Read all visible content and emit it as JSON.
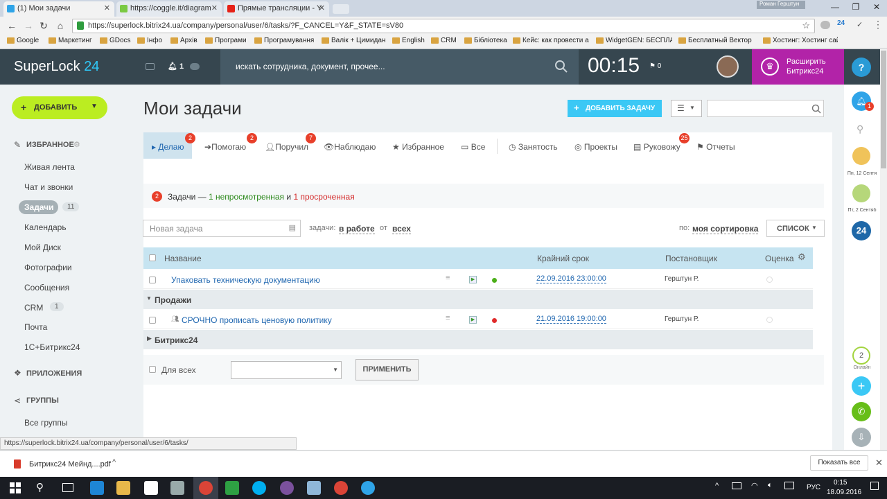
{
  "browser": {
    "tabs": [
      {
        "label": "(1) Мои задачи"
      },
      {
        "label": "https://coggle.it/diagram"
      },
      {
        "label": "Прямые трансляции - Y"
      }
    ],
    "profile_name": "Роман Герштун",
    "url": "https://superlock.bitrix24.ua/company/personal/user/6/tasks/?F_CANCEL=Y&F_STATE=sV80",
    "bookmarks": [
      "Google",
      "Маркетинг",
      "GDocs",
      "Інфо",
      "Архів",
      "Програми",
      "Програмування",
      "Валік + Цимидан",
      "English",
      "CRM",
      "Бібліотека",
      "Кейс: как провести a",
      "WidgetGEN: БЕСПЛА",
      "Бесплатный Вектор",
      "Хостинг: Хостинг сай"
    ]
  },
  "header": {
    "logo_main": "SuperLock",
    "logo_num": "24",
    "notif_count": "1",
    "search_placeholder": "искать сотрудника, документ, прочее...",
    "clock": "00:15",
    "flag_count": "0",
    "extend_line1": "Расширить",
    "extend_line2": "Битрикс24",
    "help": "?"
  },
  "left_menu": {
    "add_label": "ДОБАВИТЬ",
    "favorites_label": "ИЗБРАННОЕ",
    "items": [
      {
        "label": "Живая лента"
      },
      {
        "label": "Чат и звонки"
      },
      {
        "label": "Задачи",
        "count": "11"
      },
      {
        "label": "Календарь"
      },
      {
        "label": "Мой Диск"
      },
      {
        "label": "Фотографии"
      },
      {
        "label": "Сообщения"
      },
      {
        "label": "CRM",
        "count": "1"
      },
      {
        "label": "Почта"
      },
      {
        "label": "1С+Битрикс24"
      }
    ],
    "apps_label": "ПРИЛОЖЕНИЯ",
    "groups_label": "ГРУППЫ",
    "all_groups": "Все группы"
  },
  "main": {
    "title": "Мои задачи",
    "add_task_label": "ДОБАВИТЬ ЗАДАЧУ",
    "tabs": [
      {
        "label": "Делаю",
        "badge": "2"
      },
      {
        "label": "Помогаю",
        "badge": "2"
      },
      {
        "label": "Поручил",
        "badge": "7"
      },
      {
        "label": "Наблюдаю"
      },
      {
        "label": "Избранное"
      },
      {
        "label": "Все"
      },
      {
        "label": "Занятость"
      },
      {
        "label": "Проекты"
      },
      {
        "label": "Руковожу",
        "badge": "25"
      },
      {
        "label": "Отчеты"
      }
    ],
    "notice": {
      "count": "2",
      "prefix": "Задачи — ",
      "unseen": "1 непросмотренная",
      "and": " и ",
      "overdue": "1 просроченная"
    },
    "new_task_placeholder": "Новая задача",
    "filter": {
      "label": "задачи:",
      "state": "в работе",
      "from_label": "от",
      "from_value": "всех",
      "sort_label": "по:",
      "sort_value": "моя сортировка",
      "view_mode": "СПИСОК"
    },
    "columns": {
      "name": "Название",
      "deadline": "Крайний срок",
      "creator": "Постановщик",
      "rating": "Оценка"
    },
    "rows": [
      {
        "title": "Упаковать техническую документацию",
        "deadline": "22.09.2016 23:00:00",
        "creator": "Герштун Р.",
        "status_color": "#4caf1a"
      },
      {
        "group": "Продажи"
      },
      {
        "title": "СРОЧНО прописать ценовую политику",
        "deadline": "21.09.2016 19:00:00",
        "creator": "Герштун Р.",
        "status_color": "#e02b2b"
      },
      {
        "group": "Битрикс24"
      }
    ],
    "for_all_label": "Для всех",
    "apply_label": "ПРИМЕНИТЬ"
  },
  "right_bar": {
    "notif_badge": "1",
    "date1": "Пн, 12 Сентя",
    "date2": "Пт, 2 Сентяб",
    "online_count": "2",
    "online_label": "Онлайн",
    "b24": "24"
  },
  "status_url": "https://superlock.bitrix24.ua/company/personal/user/6/tasks/",
  "download": {
    "file": "Битрикс24 Мейнд....pdf",
    "show_all": "Показать все"
  },
  "taskbar": {
    "lang": "РУС",
    "time": "0:15",
    "date": "18.09.2016"
  },
  "colors": {
    "header_bg": "#36464f",
    "accent": "#3bc8f5",
    "add_green": "#bbed21",
    "extend_purple": "#b223a8",
    "badge_red": "#e8402b"
  }
}
